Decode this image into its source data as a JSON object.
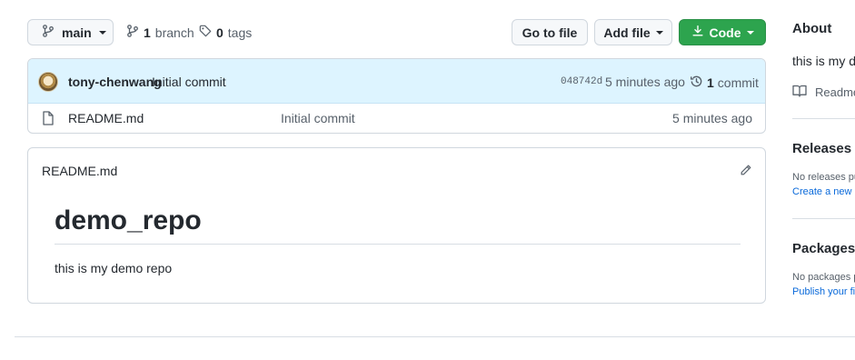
{
  "toolbar": {
    "branch_button": "main",
    "branch_count": "1",
    "branch_label": "branch",
    "tag_count": "0",
    "tag_label": "tags",
    "go_to_file": "Go to file",
    "add_file": "Add file",
    "code": "Code"
  },
  "latest_commit": {
    "author": "tony-chenwang",
    "message": "Initial commit",
    "sha": "048742d",
    "time": "5 minutes ago",
    "commit_count": "1",
    "commit_label": "commit"
  },
  "files": [
    {
      "name": "README.md",
      "commit_message": "Initial commit",
      "time": "5 minutes ago"
    }
  ],
  "readme": {
    "filename": "README.md",
    "heading": "demo_repo",
    "body": "this is my demo repo"
  },
  "sidebar": {
    "about_title": "About",
    "about_text": "this is my d",
    "readme_link": "Readme",
    "releases_title": "Releases",
    "releases_text": "No releases pu",
    "releases_link": "Create a new r",
    "packages_title": "Packages",
    "packages_text": "No packages p",
    "packages_link": "Publish your fi"
  },
  "colors": {
    "code_button": "#2da44e",
    "commit_row_bg": "#ddf4ff",
    "link": "#0969da"
  }
}
